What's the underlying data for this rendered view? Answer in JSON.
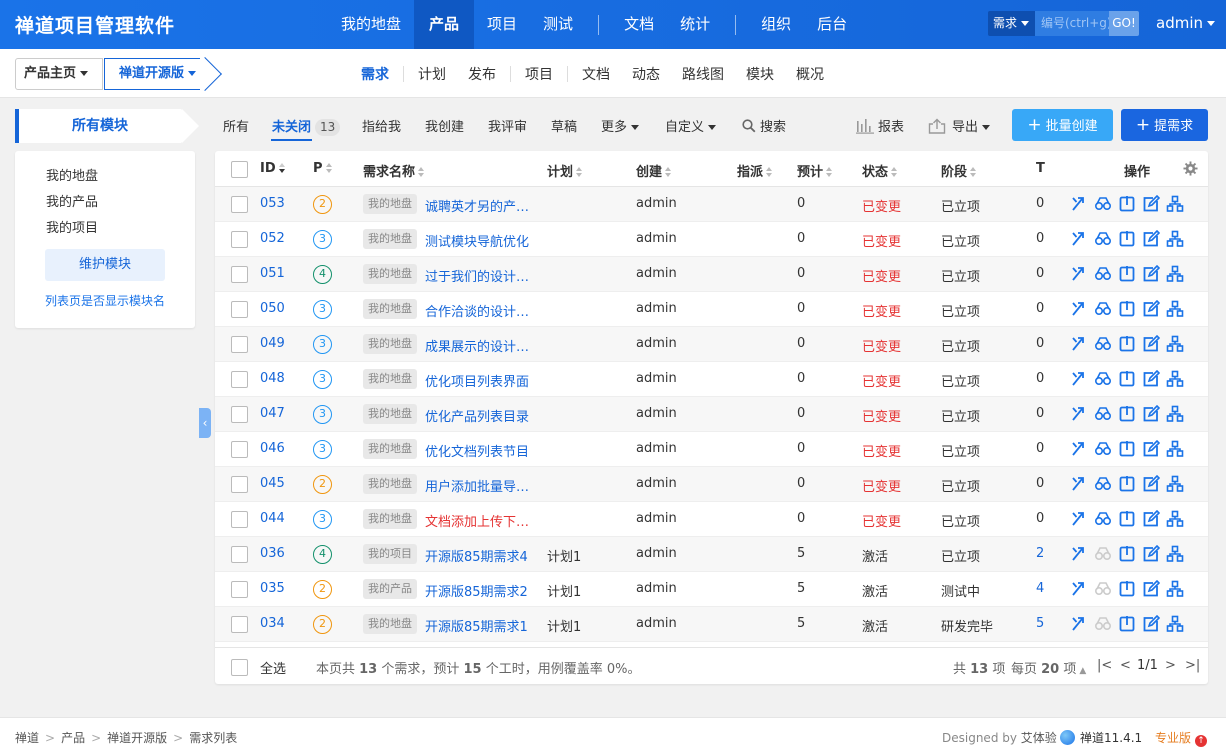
{
  "brand": "禅道项目管理软件",
  "main_nav": [
    "我的地盘",
    "产品",
    "项目",
    "测试",
    "文档",
    "统计",
    "组织",
    "后台"
  ],
  "search": {
    "type": "需求",
    "placeholder": "编号(ctrl+g)",
    "go": "GO!"
  },
  "user": "admin",
  "breadcrumb": {
    "root": "产品主页",
    "product": "禅道开源版"
  },
  "sub_nav": [
    "需求",
    "计划",
    "发布",
    "项目",
    "文档",
    "动态",
    "路线图",
    "模块",
    "概况"
  ],
  "sidebar": {
    "title": "所有模块",
    "modules": [
      "我的地盘",
      "我的产品",
      "我的项目"
    ],
    "maintain": "维护模块",
    "toggle_link": "列表页是否显示模块名"
  },
  "filters": {
    "all": "所有",
    "unclosed": "未关闭",
    "unclosed_count": "13",
    "assigned": "指给我",
    "created": "我创建",
    "reviewed": "我评审",
    "draft": "草稿",
    "more": "更多",
    "custom": "自定义",
    "search": "搜索",
    "report": "报表",
    "export": "导出",
    "batch_create": "批量创建",
    "new_story": "提需求"
  },
  "columns": {
    "id": "ID",
    "pri": "P",
    "title": "需求名称",
    "plan": "计划",
    "opened_by": "创建",
    "assigned": "指派",
    "estimate": "预计",
    "status": "状态",
    "stage": "阶段",
    "t": "T",
    "actions": "操作"
  },
  "rows": [
    {
      "id": "053",
      "pri": "2",
      "module": "我的地盘",
      "title": "诚聘英才另的产…",
      "plan": "",
      "opened_by": "admin",
      "estimate": "0",
      "status": "已变更",
      "stage": "已立项",
      "t": "0"
    },
    {
      "id": "052",
      "pri": "3",
      "module": "我的地盘",
      "title": "测试模块导航优化",
      "plan": "",
      "opened_by": "admin",
      "estimate": "0",
      "status": "已变更",
      "stage": "已立项",
      "t": "0"
    },
    {
      "id": "051",
      "pri": "4",
      "module": "我的地盘",
      "title": "过于我们的设计…",
      "plan": "",
      "opened_by": "admin",
      "estimate": "0",
      "status": "已变更",
      "stage": "已立项",
      "t": "0"
    },
    {
      "id": "050",
      "pri": "3",
      "module": "我的地盘",
      "title": "合作洽谈的设计…",
      "plan": "",
      "opened_by": "admin",
      "estimate": "0",
      "status": "已变更",
      "stage": "已立项",
      "t": "0"
    },
    {
      "id": "049",
      "pri": "3",
      "module": "我的地盘",
      "title": "成果展示的设计…",
      "plan": "",
      "opened_by": "admin",
      "estimate": "0",
      "status": "已变更",
      "stage": "已立项",
      "t": "0"
    },
    {
      "id": "048",
      "pri": "3",
      "module": "我的地盘",
      "title": "优化项目列表界面",
      "plan": "",
      "opened_by": "admin",
      "estimate": "0",
      "status": "已变更",
      "stage": "已立项",
      "t": "0"
    },
    {
      "id": "047",
      "pri": "3",
      "module": "我的地盘",
      "title": "优化产品列表目录",
      "plan": "",
      "opened_by": "admin",
      "estimate": "0",
      "status": "已变更",
      "stage": "已立项",
      "t": "0"
    },
    {
      "id": "046",
      "pri": "3",
      "module": "我的地盘",
      "title": "优化文档列表节目",
      "plan": "",
      "opened_by": "admin",
      "estimate": "0",
      "status": "已变更",
      "stage": "已立项",
      "t": "0"
    },
    {
      "id": "045",
      "pri": "2",
      "module": "我的地盘",
      "title": "用户添加批量导…",
      "plan": "",
      "opened_by": "admin",
      "estimate": "0",
      "status": "已变更",
      "stage": "已立项",
      "t": "0"
    },
    {
      "id": "044",
      "pri": "3",
      "module": "我的地盘",
      "title": "文档添加上传下…",
      "plan": "",
      "opened_by": "admin",
      "estimate": "0",
      "status": "已变更",
      "stage": "已立项",
      "t": "0",
      "title_color": "#e53333"
    },
    {
      "id": "036",
      "pri": "4",
      "module": "我的项目",
      "title": "开源版85期需求4",
      "plan": "计划1",
      "opened_by": "admin",
      "estimate": "5",
      "status": "激活",
      "stage": "已立项",
      "t": "2"
    },
    {
      "id": "035",
      "pri": "2",
      "module": "我的产品",
      "title": "开源版85期需求2",
      "plan": "计划1",
      "opened_by": "admin",
      "estimate": "5",
      "status": "激活",
      "stage": "测试中",
      "t": "4"
    },
    {
      "id": "034",
      "pri": "2",
      "module": "我的地盘",
      "title": "开源版85期需求1",
      "plan": "计划1",
      "opened_by": "admin",
      "estimate": "5",
      "status": "激活",
      "stage": "研发完毕",
      "t": "5"
    }
  ],
  "footer_bar": {
    "select_all": "全选",
    "summary_pre": "本页共 ",
    "summary_count": "13",
    "summary_mid": " 个需求，预计 ",
    "summary_hours": "15",
    "summary_post": " 个工时，用例覆盖率 0%。",
    "total_pre": "共 ",
    "total": "13",
    "total_post": " 项",
    "per_page_pre": "每页 ",
    "per_page": "20",
    "per_page_post": " 项",
    "page": "1/1"
  },
  "page_footer": {
    "crumbs": [
      "禅道",
      "产品",
      "禅道开源版",
      "需求列表"
    ],
    "designed_by": "Designed by",
    "designer": "艾体验",
    "version": "禅道11.4.1",
    "edition": "专业版"
  },
  "colors": {
    "primary": "#1565d8",
    "changed_status": "#e53333",
    "pri2": "#f0960e",
    "pri3": "#2196f3",
    "pri4": "#12906b"
  }
}
